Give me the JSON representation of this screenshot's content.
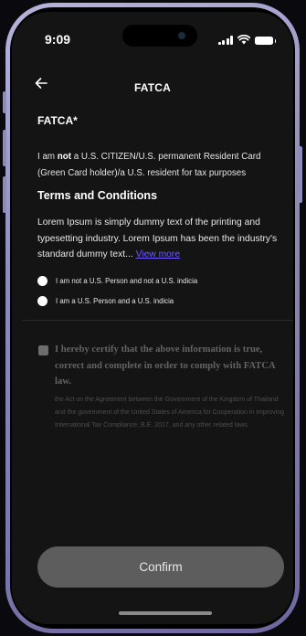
{
  "status_bar": {
    "time": "9:09"
  },
  "header": {
    "title": "FATCA"
  },
  "fatca": {
    "heading": "FATCA*",
    "statement_prefix": "I am ",
    "statement_emphasis": "not",
    "statement_suffix": " a U.S. CITIZEN/U.S. permanent Resident Card (Green Card holder)/a U.S. resident for tax purposes"
  },
  "terms": {
    "heading": "Terms and Conditions",
    "body": "Lorem Ipsum is simply dummy text of the printing and typesetting industry. Lorem Ipsum has been the industry's standard dummy text... ",
    "view_more_label": "View more"
  },
  "options": [
    {
      "label": "I am not a U.S. Person and not a U.S. indicia",
      "selected": false
    },
    {
      "label": "I am a U.S. Person and a U.S. indicia",
      "selected": false
    }
  ],
  "certification": {
    "checked": false,
    "text": "I hereby certify that the above information is true, correct and complete in order to comply with FATCA law.",
    "note": "the Act on the Agreement between the Government of the Kingdom of Thailand and the government of the United States of America for Cooperation in Improving International Tax Compliance, B.E. 2017, and any other related laws."
  },
  "footer": {
    "confirm_label": "Confirm"
  },
  "colors": {
    "screen_background": "#141414",
    "link": "#6f5bff",
    "button_disabled": "#5d5d5d",
    "phone_frame": "#8e8ab8"
  }
}
